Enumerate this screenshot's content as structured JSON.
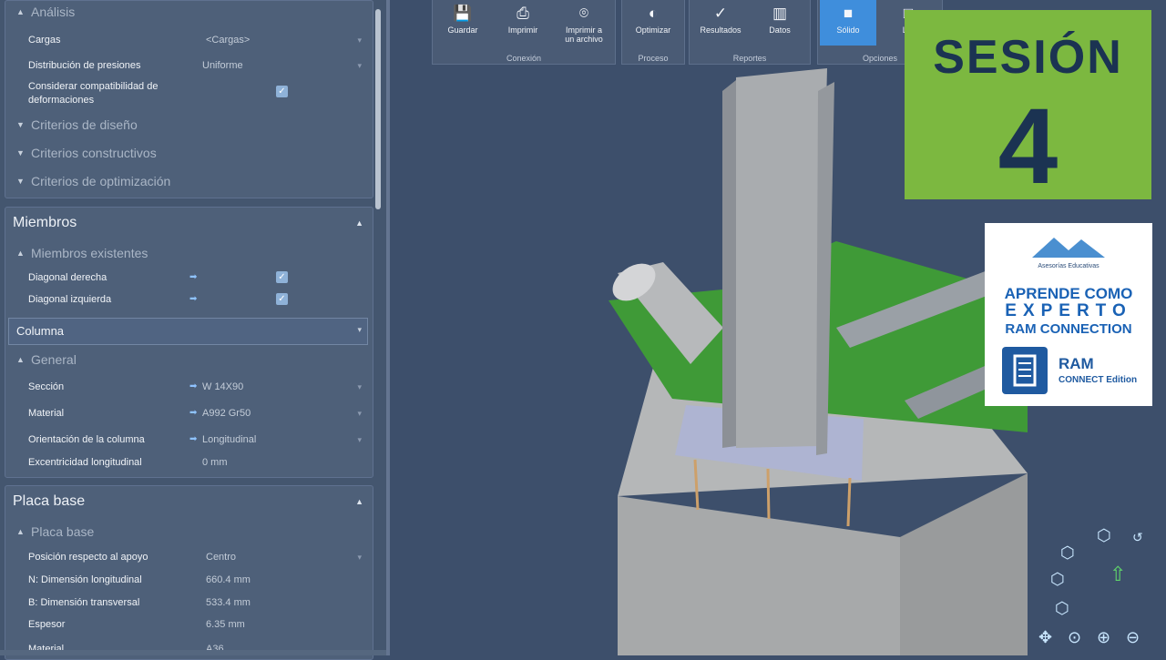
{
  "panel": {
    "analisis": {
      "title": "Análisis",
      "rows": [
        {
          "label": "Cargas",
          "value": "<Cargas>"
        },
        {
          "label": "Distribución de presiones",
          "value": "Uniforme"
        },
        {
          "label": "Considerar compatibilidad de",
          "label2": "deformaciones",
          "checked": true
        }
      ],
      "collapsed": [
        "Criterios de diseño",
        "Criterios constructivos",
        "Criterios de optimización"
      ]
    },
    "miembros": {
      "title": "Miembros",
      "sub": "Miembros existentes",
      "rows": [
        {
          "label": "Diagonal derecha",
          "checked": true
        },
        {
          "label": "Diagonal izquierda",
          "checked": true
        }
      ],
      "selector": "Columna",
      "general": "General",
      "general_rows": [
        {
          "label": "Sección",
          "value": "W 14X90"
        },
        {
          "label": "Material",
          "value": "A992 Gr50"
        },
        {
          "label": "Orientación de la columna",
          "value": "Longitudinal"
        },
        {
          "label": "Excentricidad longitudinal",
          "value": "0 mm"
        }
      ]
    },
    "placa": {
      "title": "Placa base",
      "sub": "Placa base",
      "rows": [
        {
          "label": "Posición respecto al apoyo",
          "value": "Centro"
        },
        {
          "label": "N: Dimensión longitudinal",
          "value": "660.4 mm"
        },
        {
          "label": "B: Dimensión transversal",
          "value": "533.4 mm"
        },
        {
          "label": "Espesor",
          "value": "6.35 mm"
        },
        {
          "label": "Material",
          "value": "A36"
        }
      ]
    }
  },
  "ribbon": {
    "buttons": [
      {
        "label": "Guardar",
        "icon": "save-icon"
      },
      {
        "label": "Imprimir",
        "icon": "print-icon"
      },
      {
        "label": "Imprimir a",
        "label2": "un archivo",
        "icon": "camera-icon"
      },
      {
        "label": "Optimizar",
        "icon": "optimize-icon"
      },
      {
        "label": "Resultados",
        "icon": "results-icon"
      },
      {
        "label": "Datos",
        "icon": "data-icon"
      },
      {
        "label": "Sólido",
        "icon": "cube-solid-icon",
        "active": true
      },
      {
        "label": "Lín",
        "icon": "cube-wire-icon"
      }
    ],
    "groups": [
      "Conexión",
      "Proceso",
      "Reportes",
      "Opciones"
    ]
  },
  "overlay": {
    "sesion_word": "SESIÓN",
    "sesion_number": "4",
    "promo_brand": "Asesorías Educativas",
    "promo_line1": "APRENDE COMO",
    "promo_line2": "EXPERTO",
    "promo_line3": "RAM CONNECTION",
    "promo_ram": "RAM",
    "promo_edition": "CONNECT Edition"
  },
  "colors": {
    "panel_bg": "#44566f",
    "viewport_bg": "#3d4f6b",
    "accent_blue": "#3f8edc",
    "sesion_green": "#7cb840",
    "sesion_text": "#1b3352",
    "plate_green": "#3f9a37"
  }
}
